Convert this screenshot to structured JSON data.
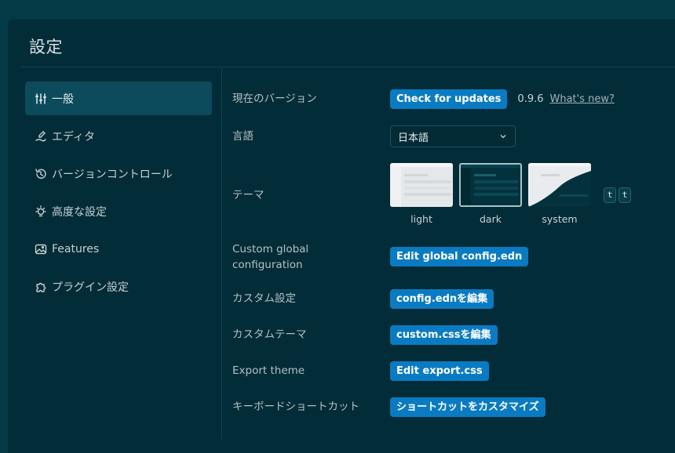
{
  "header": {
    "title": "設定"
  },
  "sidebar": {
    "items": [
      {
        "label": "一般",
        "icon": "sliders-icon",
        "active": true
      },
      {
        "label": "エディタ",
        "icon": "writing-icon"
      },
      {
        "label": "バージョンコントロール",
        "icon": "history-icon"
      },
      {
        "label": "高度な設定",
        "icon": "bulb-icon"
      },
      {
        "label": "Features",
        "icon": "image-icon"
      },
      {
        "label": "プラグイン設定",
        "icon": "puzzle-icon"
      }
    ]
  },
  "general": {
    "version_label": "現在のバージョン",
    "check_updates": "Check for updates",
    "version": "0.9.6",
    "whats_new": "What's new?",
    "language_label": "言語",
    "language_value": "日本語",
    "theme_label": "テーマ",
    "themes": [
      {
        "name": "light"
      },
      {
        "name": "dark",
        "selected": true
      },
      {
        "name": "system"
      }
    ],
    "theme_shortcut": [
      "t",
      "t"
    ],
    "custom_global_label": "Custom global configuration",
    "custom_global_button": "Edit global config.edn",
    "custom_settings_label": "カスタム設定",
    "custom_settings_button": "config.ednを編集",
    "custom_theme_label": "カスタムテーマ",
    "custom_theme_button": "custom.cssを編集",
    "export_theme_label": "Export theme",
    "export_theme_button": "Edit export.css",
    "shortcuts_label": "キーボードショートカット",
    "shortcuts_button": "ショートカットをカスタマイズ"
  },
  "colors": {
    "accent": "#0a7bc2",
    "panel": "#022c37",
    "background": "#053a47",
    "sidebar_active": "#0c4b5c"
  }
}
